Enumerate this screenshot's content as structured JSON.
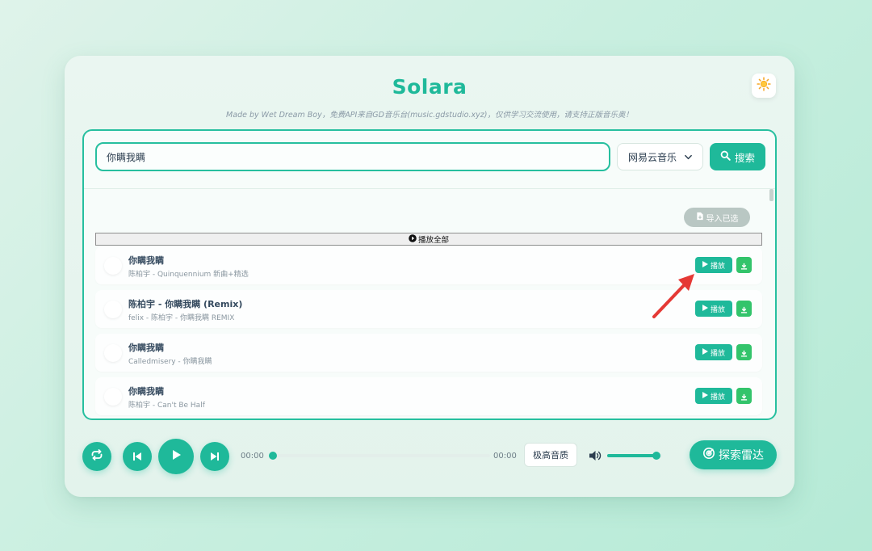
{
  "app": {
    "title": "Solara",
    "subtitle": "Made by Wet Dream Boy，免费API来自GD音乐台(music.gdstudio.xyz)，仅供学习交流使用，请支持正版音乐奥！"
  },
  "colors": {
    "accent": "#1fb99a",
    "download": "#33c46b",
    "disabled": "#b9c7c3"
  },
  "search": {
    "value": "你瞒我瞒",
    "source": "网易云音乐",
    "button_label": "搜索"
  },
  "actions": {
    "import_label": "导入已选",
    "play_all_label": "播放全部"
  },
  "songs": [
    {
      "name": "你瞒我瞒",
      "meta": "陈柏宇 - Quinquennium 新曲+精选",
      "play_label": "播放"
    },
    {
      "name": "陈柏宇 - 你瞒我瞒 (Remix)",
      "meta": "felix - 陈柏宇 - 你瞒我瞒 REMIX",
      "play_label": "播放"
    },
    {
      "name": "你瞒我瞒",
      "meta": "Calledmisery - 你瞒我瞒",
      "play_label": "播放"
    },
    {
      "name": "你瞒我瞒",
      "meta": "陈柏宇 - Can't Be Half",
      "play_label": "播放"
    }
  ],
  "player": {
    "current_time": "00:00",
    "duration": "00:00",
    "progress": 0,
    "quality_label": "极高音质",
    "volume": 0.9,
    "radar_label": "探索雷达"
  }
}
